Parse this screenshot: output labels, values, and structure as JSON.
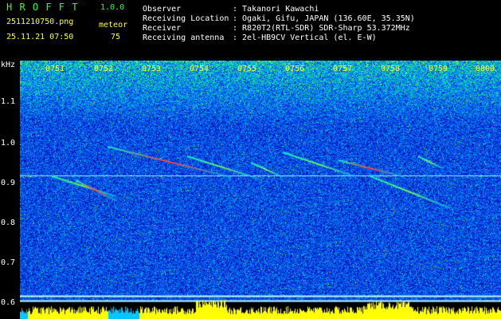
{
  "header": {
    "app_title": "H R O F F T",
    "version": "1.0.0",
    "filename": "2511210750.png",
    "datetime": "25.11.21 07:50",
    "meteor_label": "meteor",
    "meteor_count": "75",
    "observer_label": "Observer",
    "observer_value": ": Takanori Kawachi",
    "location_label": "Receiving Location",
    "location_value": ": Ogaki, Gifu, JAPAN (136.60E, 35.35N)",
    "receiver_label": "Receiver",
    "receiver_value": ": R820T2(RTL-SDR) SDR-Sharp 53.372MHz",
    "antenna_label": "Receiving antenna",
    "antenna_value": ": 2el-HB9CV Vertical (el. E-W)"
  },
  "axis": {
    "y_unit": "kHz",
    "y_ticks": [
      "1.1",
      "1.0",
      "0.9",
      "0.8",
      "0.7",
      "0.6"
    ],
    "x_ticks": [
      "0751",
      "0752",
      "0753",
      "0754",
      "0755",
      "0756",
      "0757",
      "0758",
      "0759",
      "0800"
    ]
  },
  "colors": {
    "background": "#000000",
    "header_text": "#ffffff",
    "title_green": "#33ff33",
    "tick_yellow": "#ffff33",
    "level_bar_yellow": "#ffff00",
    "level_bar_cyan": "#00c8ff",
    "spectrum_low": "#000064",
    "spectrum_high": "#ff3030"
  }
}
